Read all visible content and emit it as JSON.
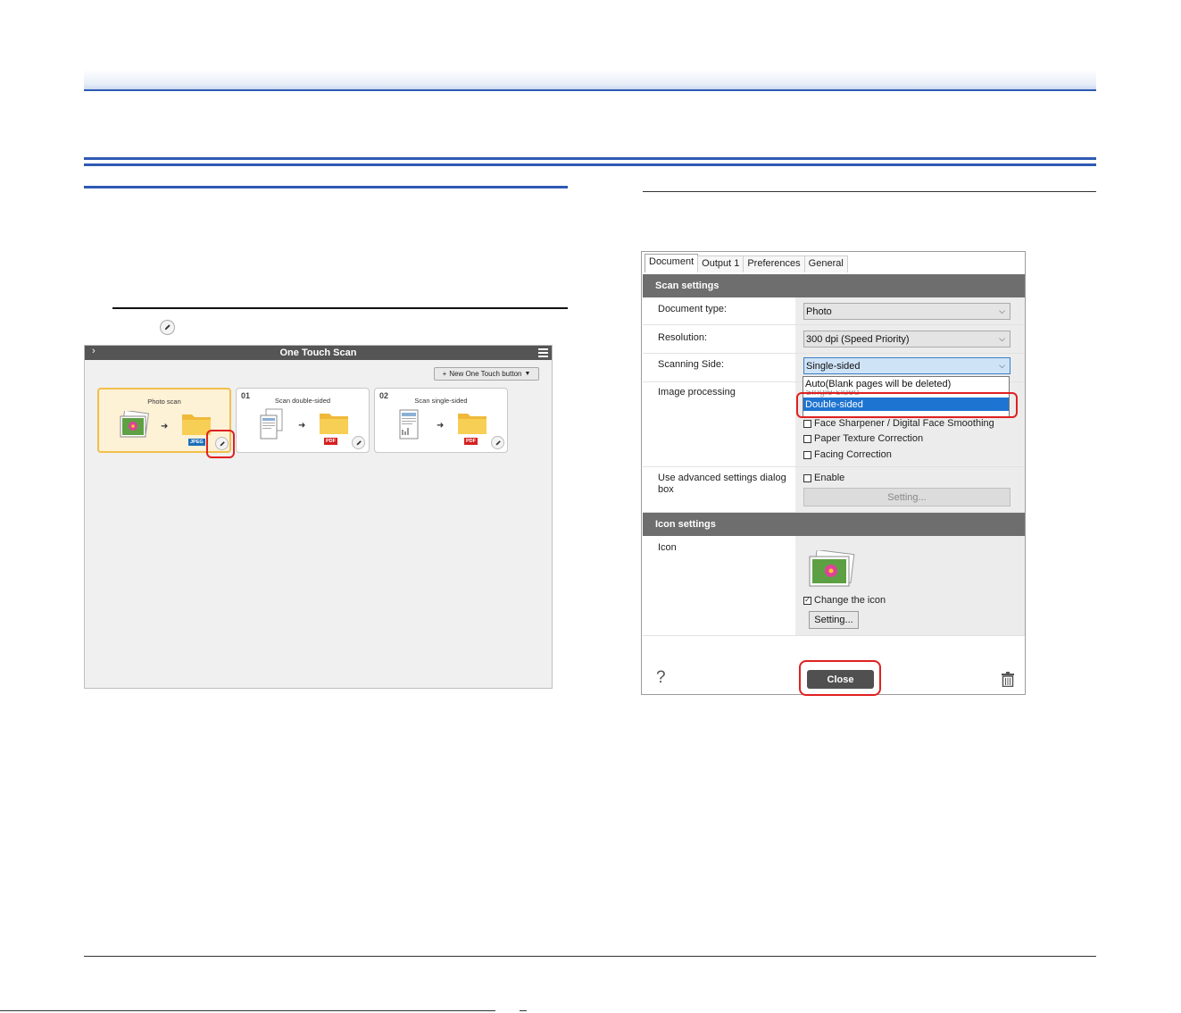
{
  "one_touch_scan": {
    "title": "One Touch Scan",
    "expand_icon": "chevron-right-icon",
    "menu_icon": "hamburger-menu-icon",
    "new_button_label": "New One Touch button",
    "cards": [
      {
        "number": "",
        "name": "Photo scan",
        "format": "JPEG",
        "selected": true
      },
      {
        "number": "01",
        "name": "Scan double-sided",
        "format": "PDF",
        "selected": false
      },
      {
        "number": "02",
        "name": "Scan single-sided",
        "format": "PDF",
        "selected": false
      }
    ]
  },
  "dialog": {
    "tabs": [
      "Document",
      "Output 1",
      "Preferences",
      "General"
    ],
    "active_tab": "Document",
    "scan_settings_header": "Scan settings",
    "document_type": {
      "label": "Document type:",
      "value": "Photo"
    },
    "resolution": {
      "label": "Resolution:",
      "value": "300 dpi (Speed Priority)"
    },
    "scanning_side": {
      "label": "Scanning Side:",
      "value": "Single-sided",
      "options": [
        "Auto(Blank pages will be deleted)",
        "Single-sided",
        "Double-sided"
      ],
      "highlighted": "Double-sided"
    },
    "image_processing": {
      "label": "Image processing",
      "options": [
        {
          "label": "Face Sharpener / Digital Face Smoothing",
          "checked": false
        },
        {
          "label": "Paper Texture Correction",
          "checked": false
        },
        {
          "label": "Facing Correction",
          "checked": false
        }
      ]
    },
    "advanced": {
      "label": "Use advanced settings dialog box",
      "enable_label": "Enable",
      "enable_checked": false,
      "setting_button": "Setting..."
    },
    "icon_settings_header": "Icon settings",
    "icon": {
      "label": "Icon",
      "change_label": "Change the icon",
      "change_checked": true,
      "setting_button": "Setting..."
    },
    "close_button": "Close",
    "help_label": "?"
  },
  "colors": {
    "accent_blue": "#2f5ab4",
    "highlight_red": "#e02020",
    "selection_blue": "#1e74d1",
    "card_selected": "#fdf1d6"
  }
}
